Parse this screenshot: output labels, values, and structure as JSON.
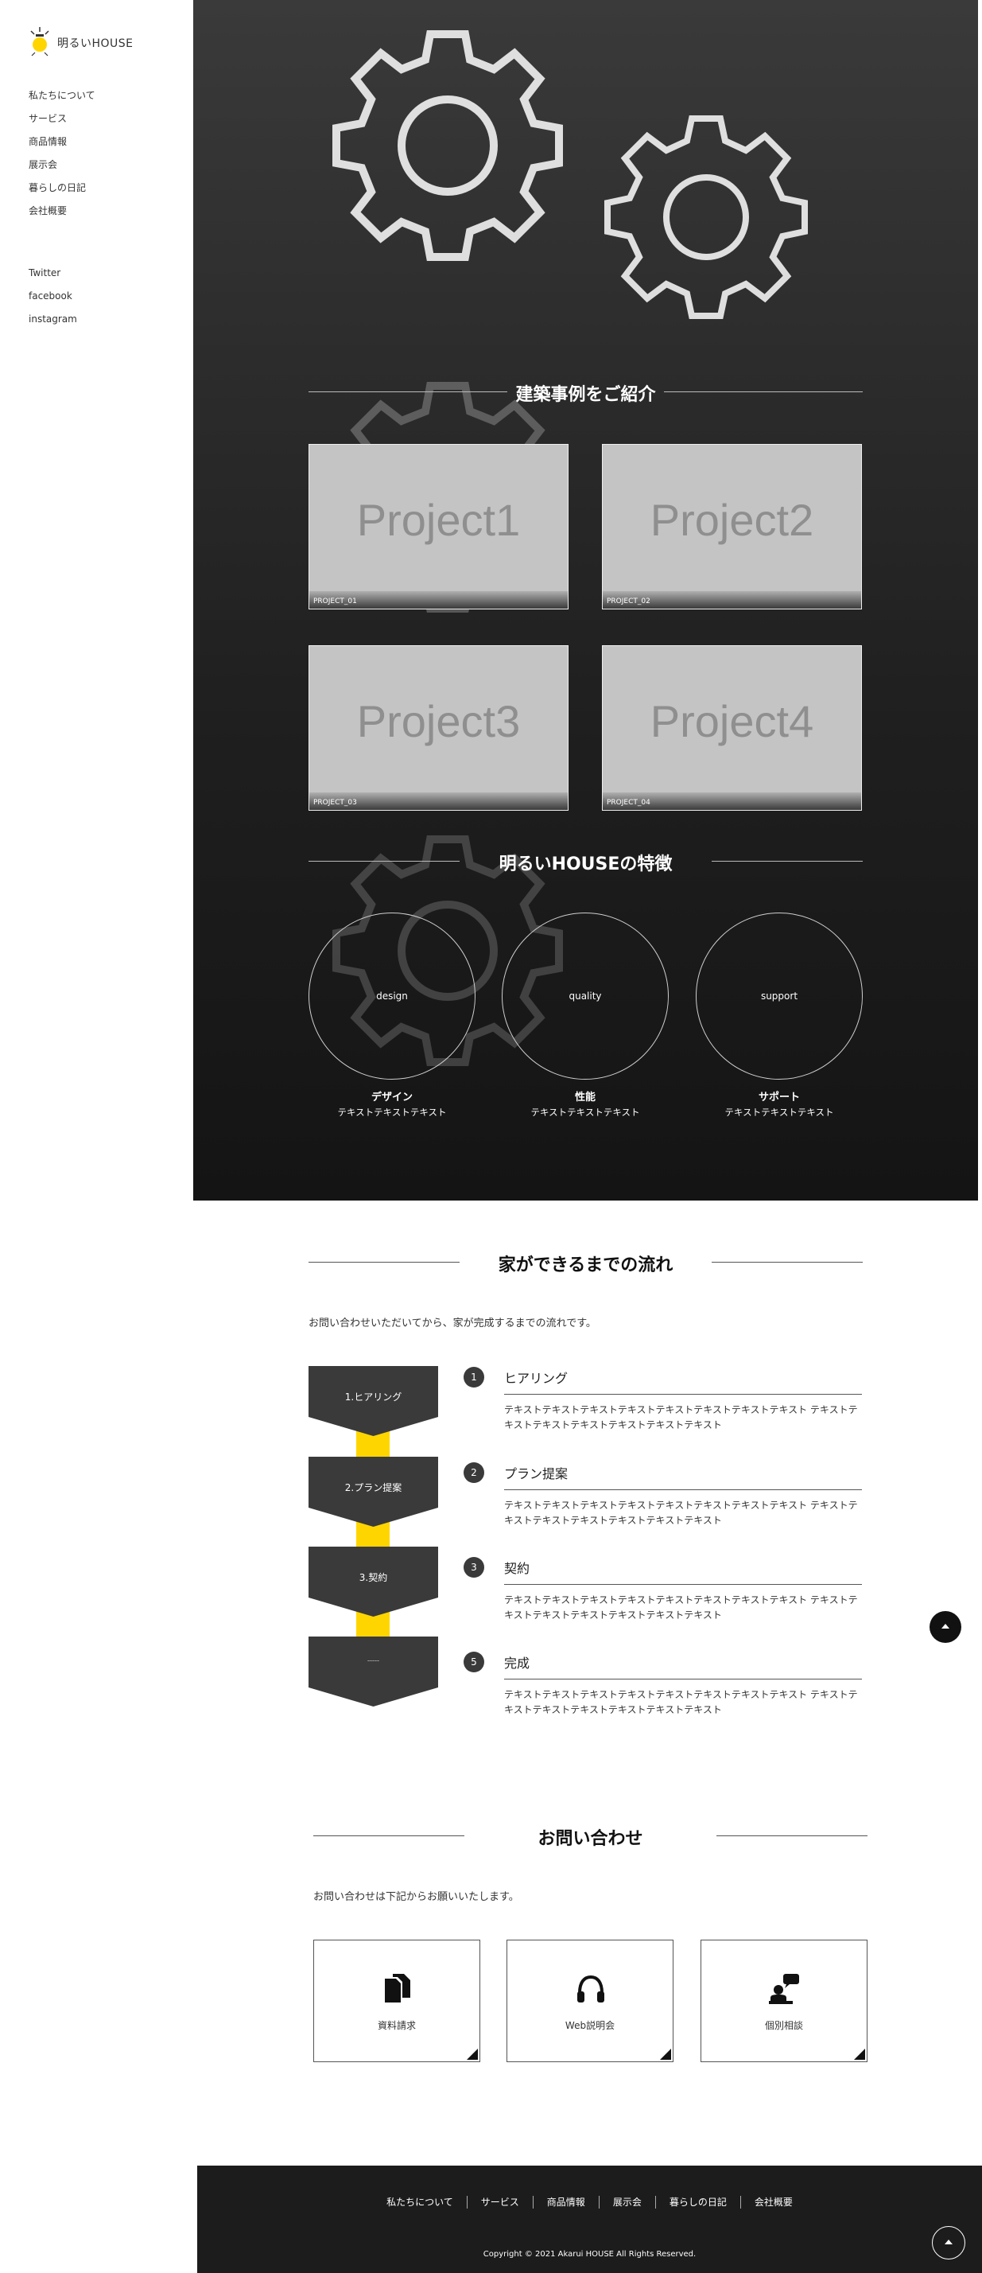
{
  "brand": {
    "name": "明るいHOUSE",
    "accent": "#ffd500"
  },
  "sidebar": {
    "nav": [
      "私たちについて",
      "サービス",
      "商品情報",
      "展示会",
      "暮らしの日記",
      "会社概要"
    ],
    "social": [
      "Twitter",
      "facebook",
      "instagram"
    ]
  },
  "works": {
    "title": "建築事例をご紹介",
    "projects": [
      {
        "name": "Project1",
        "code": "PROJECT_01"
      },
      {
        "name": "Project2",
        "code": "PROJECT_02"
      },
      {
        "name": "Project3",
        "code": "PROJECT_03"
      },
      {
        "name": "Project4",
        "code": "PROJECT_04"
      }
    ]
  },
  "features": {
    "title": "明るいHOUSEの特徴",
    "items": [
      {
        "circle": "design",
        "name": "デザイン",
        "text": "テキストテキストテキスト"
      },
      {
        "circle": "quality",
        "name": "性能",
        "text": "テキストテキストテキスト"
      },
      {
        "circle": "support",
        "name": "サポート",
        "text": "テキストテキストテキスト"
      }
    ]
  },
  "flow": {
    "title": "家ができるまでの流れ",
    "lead": "お問い合わせいただいてから、家が完成するまでの流れです。",
    "chevrons": [
      "1.ヒアリング",
      "2.プラン提案",
      "3.契約",
      "ｰｰｰｰｰ"
    ],
    "steps": [
      {
        "num": "1",
        "title": "ヒアリング",
        "text": "テキストテキストテキストテキストテキストテキストテキストテキスト テキストテキストテキストテキストテキストテキストテキスト"
      },
      {
        "num": "2",
        "title": "プラン提案",
        "text": "テキストテキストテキストテキストテキストテキストテキストテキスト テキストテキストテキストテキストテキストテキストテキスト"
      },
      {
        "num": "3",
        "title": "契約",
        "text": "テキストテキストテキストテキストテキストテキストテキストテキスト テキストテキストテキストテキストテキストテキストテキスト"
      },
      {
        "num": "5",
        "title": "完成",
        "text": "テキストテキストテキストテキストテキストテキストテキストテキスト テキストテキストテキストテキストテキストテキストテキスト"
      }
    ]
  },
  "contact": {
    "title": "お問い合わせ",
    "lead": "お問い合わせは下記からお願いいたします。",
    "cards": [
      {
        "label": "資料請求",
        "icon": "document-icon"
      },
      {
        "label": "Web説明会",
        "icon": "headphones-icon"
      },
      {
        "label": "個別相談",
        "icon": "consult-icon"
      }
    ]
  },
  "footer": {
    "nav": [
      "私たちについて",
      "サービス",
      "商品情報",
      "展示会",
      "暮らしの日記",
      "会社概要"
    ],
    "copyright": "Copyright © 2021 Akarui HOUSE All Rights Reserved."
  }
}
